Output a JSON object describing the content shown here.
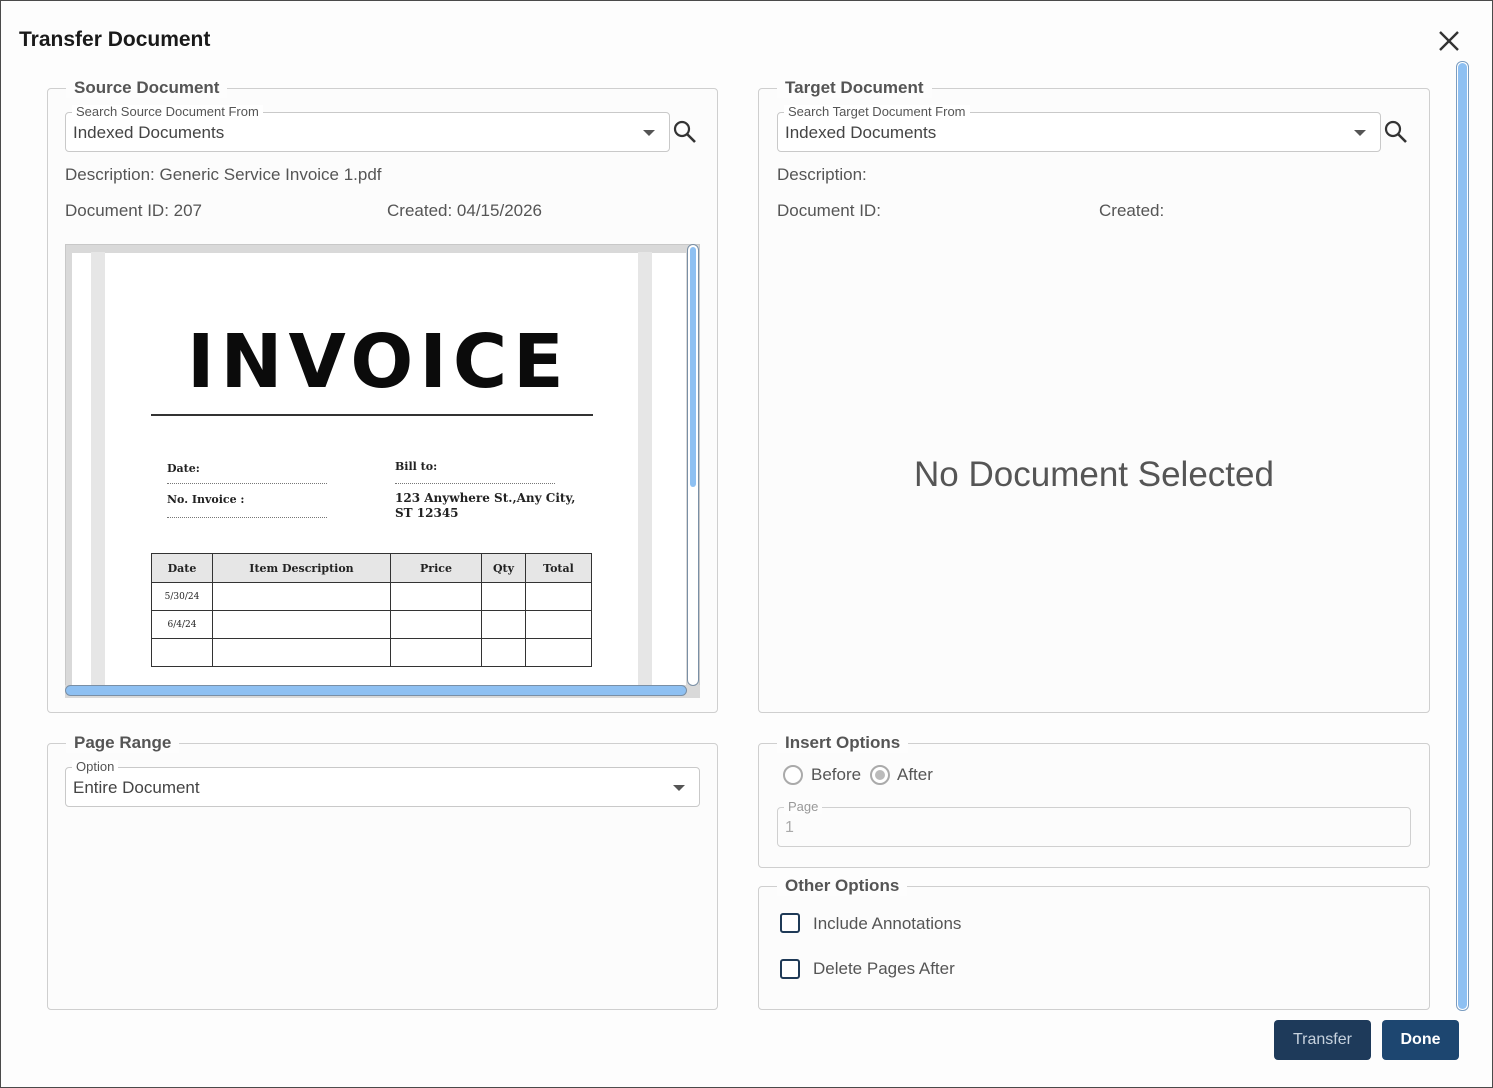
{
  "dialog": {
    "title": "Transfer Document"
  },
  "source": {
    "legend": "Source Document",
    "search_label": "Search Source Document From",
    "search_value": "Indexed Documents",
    "description": "Description: Generic Service Invoice 1.pdf",
    "document_id": "Document ID: 207",
    "created": "Created: 04/15/2026",
    "preview": {
      "title": "INVOICE",
      "date_label": "Date:",
      "invoice_label": "No. Invoice :",
      "bill_to_label": "Bill to:",
      "address": "123 Anywhere St.,Any City, ST 12345",
      "table_headers": [
        "Date",
        "Item Description",
        "Price",
        "Qty",
        "Total"
      ],
      "table_rows": [
        [
          "5/30/24",
          "",
          "",
          "",
          ""
        ],
        [
          "6/4/24",
          "",
          "",
          "",
          ""
        ],
        [
          "",
          "",
          "",
          "",
          ""
        ],
        [
          "",
          "",
          "",
          "",
          ""
        ]
      ]
    }
  },
  "target": {
    "legend": "Target Document",
    "search_label": "Search Target Document From",
    "search_value": "Indexed Documents",
    "description": "Description:",
    "document_id": "Document ID:",
    "created": "Created:",
    "empty_message": "No Document Selected"
  },
  "page_range": {
    "legend": "Page Range",
    "option_label": "Option",
    "option_value": "Entire Document"
  },
  "insert_options": {
    "legend": "Insert Options",
    "before_label": "Before",
    "after_label": "After",
    "selected": "After",
    "page_label": "Page",
    "page_value": "1"
  },
  "other_options": {
    "legend": "Other Options",
    "include_annotations": "Include Annotations",
    "delete_pages_after": "Delete Pages After"
  },
  "buttons": {
    "transfer": "Transfer",
    "done": "Done"
  },
  "icons": {
    "close": "close-icon",
    "search": "search-icon",
    "dropdown": "chevron-down-icon"
  },
  "colors": {
    "primary_button": "#1d4670",
    "disabled_button": "#1e3a5a",
    "scrollbar": "#8ec0f2"
  }
}
